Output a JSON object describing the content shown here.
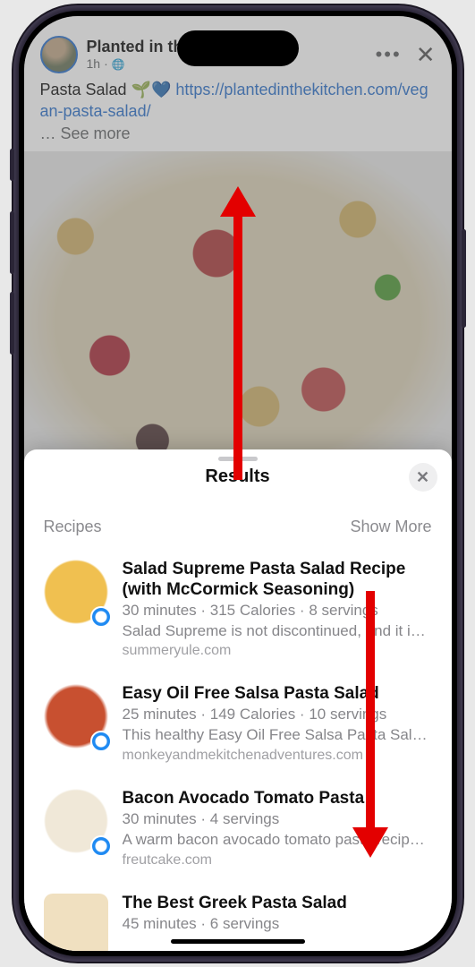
{
  "post": {
    "page_name": "Planted in th",
    "time": "1h",
    "visibility_icon": "globe-icon",
    "text_prefix": "Pasta Salad 🌱💙 ",
    "link": "https://plantedinthekitchen.com/vegan-pasta-salad/",
    "see_more": "… See more",
    "header_more": "•••",
    "header_close": "✕"
  },
  "sheet": {
    "title": "Results",
    "close_glyph": "✕",
    "section_label": "Recipes",
    "show_more": "Show More"
  },
  "recipes": [
    {
      "title": "Salad Supreme Pasta Salad Recipe (with McCormick Seasoning)",
      "meta": "30 minutes · 315 Calories · 8 servings",
      "desc": "Salad Supreme is not discontinued, and it is…",
      "source": "summeryule.com"
    },
    {
      "title": "Easy Oil Free Salsa Pasta Salad",
      "meta": "25 minutes · 149 Calories · 10 servings",
      "desc": "This healthy Easy Oil Free Salsa Pasta Salad…",
      "source": "monkeyandmekitchenadventures.com"
    },
    {
      "title": "Bacon Avocado Tomato Pasta",
      "meta": "30 minutes · 4 servings",
      "desc": "A warm bacon avocado tomato pasta recipe…",
      "source": "freutcake.com"
    },
    {
      "title": "The Best Greek Pasta Salad",
      "meta": "45 minutes · 6 servings",
      "desc": "",
      "source": ""
    }
  ]
}
